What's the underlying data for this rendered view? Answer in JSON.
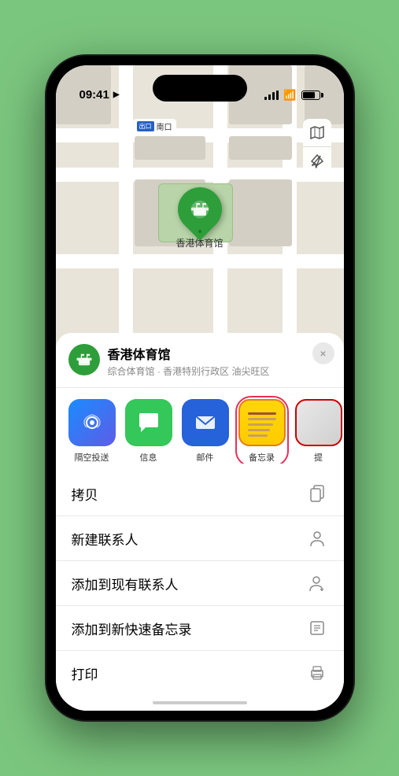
{
  "status_bar": {
    "time": "09:41",
    "location_arrow": "▶"
  },
  "map": {
    "label_badge": "出口",
    "label_text": "南口",
    "controls": {
      "map_icon": "🗺",
      "location_icon": "➤"
    }
  },
  "place_card": {
    "name": "香港体育馆",
    "subtitle": "综合体育馆 · 香港特别行政区 油尖旺区",
    "close_label": "×"
  },
  "share_row": {
    "items": [
      {
        "id": "airdrop",
        "label": "隔空投送"
      },
      {
        "id": "messages",
        "label": "信息"
      },
      {
        "id": "mail",
        "label": "邮件"
      },
      {
        "id": "notes",
        "label": "备忘录"
      },
      {
        "id": "more",
        "label": "提"
      }
    ]
  },
  "actions": [
    {
      "label": "拷贝",
      "icon": "copy"
    },
    {
      "label": "新建联系人",
      "icon": "person"
    },
    {
      "label": "添加到现有联系人",
      "icon": "person-add"
    },
    {
      "label": "添加到新快速备忘录",
      "icon": "note"
    },
    {
      "label": "打印",
      "icon": "print"
    }
  ]
}
